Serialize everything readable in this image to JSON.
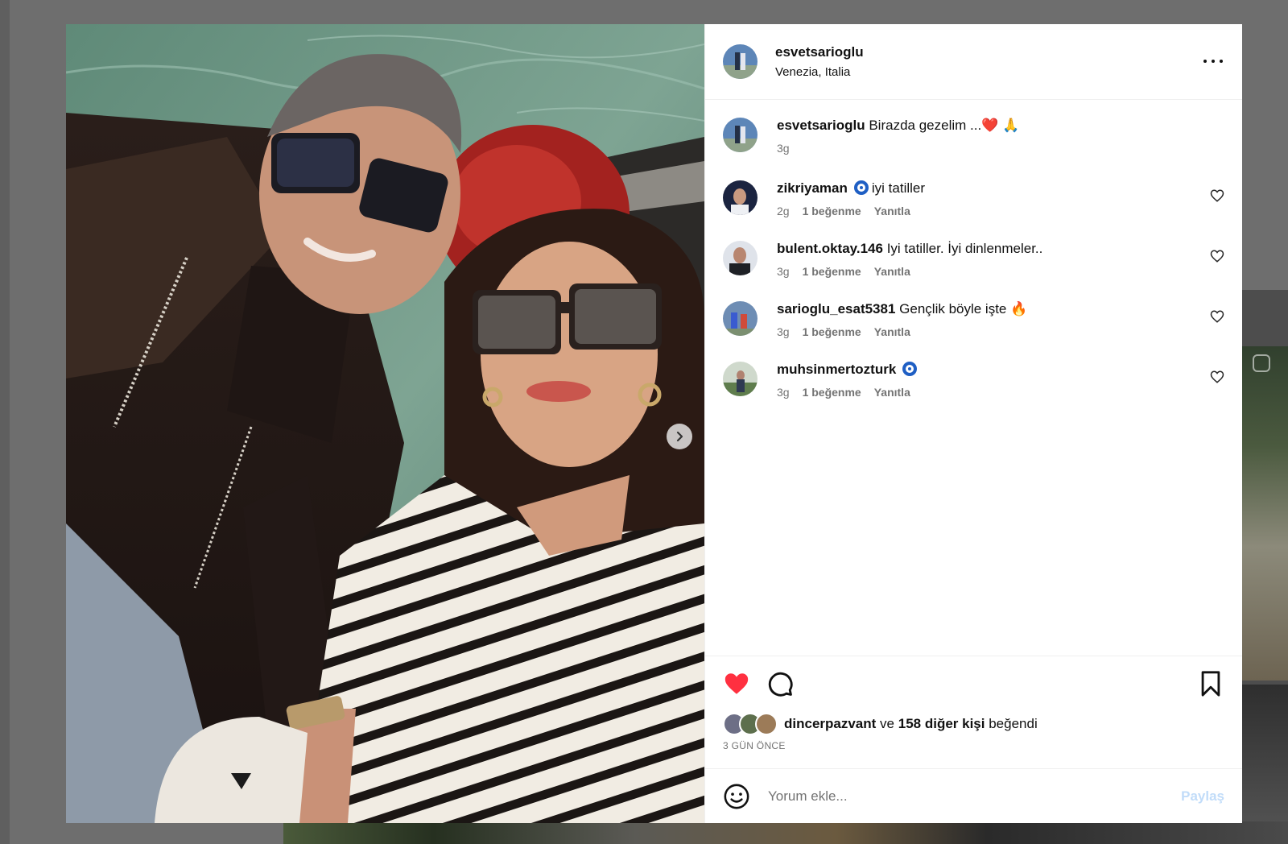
{
  "post": {
    "username": "esvetsarioglu",
    "location": "Venezia, Italia",
    "caption": {
      "username": "esvetsarioglu",
      "text": "Birazda gezelim ...",
      "emojis": "❤️ 🙏",
      "time": "3g"
    }
  },
  "comments": [
    {
      "username": "zikriyaman",
      "verified": true,
      "text": "iyi tatiller",
      "time": "2g",
      "likes": "1 beğenme",
      "reply": "Yanıtla"
    },
    {
      "username": "bulent.oktay.146",
      "verified": false,
      "text": "Iyi tatiller. İyi dinlenmeler..",
      "time": "3g",
      "likes": "1 beğenme",
      "reply": "Yanıtla"
    },
    {
      "username": "sarioglu_esat5381",
      "verified": false,
      "text": "Gençlik böyle işte 🔥",
      "time": "3g",
      "likes": "1 beğenme",
      "reply": "Yanıtla"
    },
    {
      "username": "muhsinmertozturk",
      "verified": true,
      "text": "",
      "time": "3g",
      "likes": "1 beğenme",
      "reply": "Yanıtla"
    }
  ],
  "likes": {
    "first_user": "dincerpazvant",
    "connector": "ve",
    "others": "158 diğer kişi",
    "suffix": "beğendi",
    "time_ago": "3 GÜN ÖNCE"
  },
  "comment_input": {
    "placeholder": "Yorum ekle...",
    "share_label": "Paylaş"
  },
  "colors": {
    "like_red": "#ff3040",
    "share_disabled": "#c1dcf9",
    "verified_blue": "#1f5fc4"
  },
  "icons": [
    "heart-icon",
    "comment-icon",
    "bookmark-icon",
    "emoji-icon",
    "more-icon",
    "chevron-right-icon"
  ]
}
